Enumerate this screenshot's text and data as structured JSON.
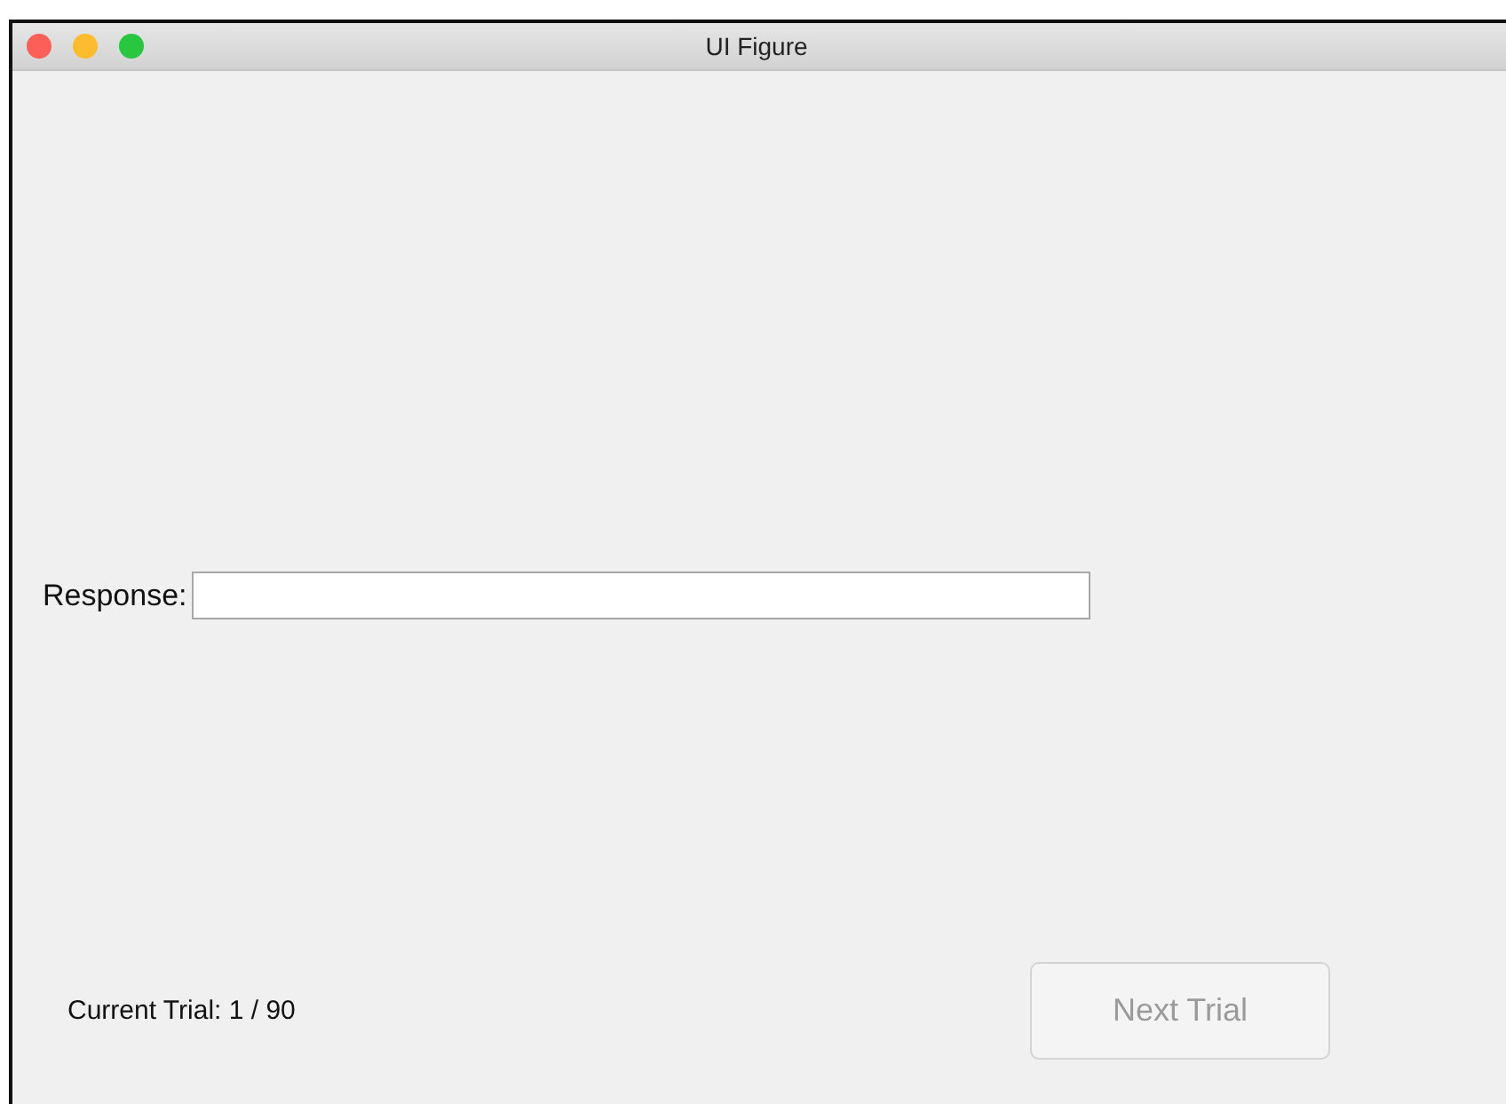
{
  "window": {
    "title": "UI Figure"
  },
  "response": {
    "label": "Response:"
  },
  "trial_label": "Current Trial: 1 / 90",
  "next_button": {
    "label": "Next Trial",
    "disabled": true
  }
}
